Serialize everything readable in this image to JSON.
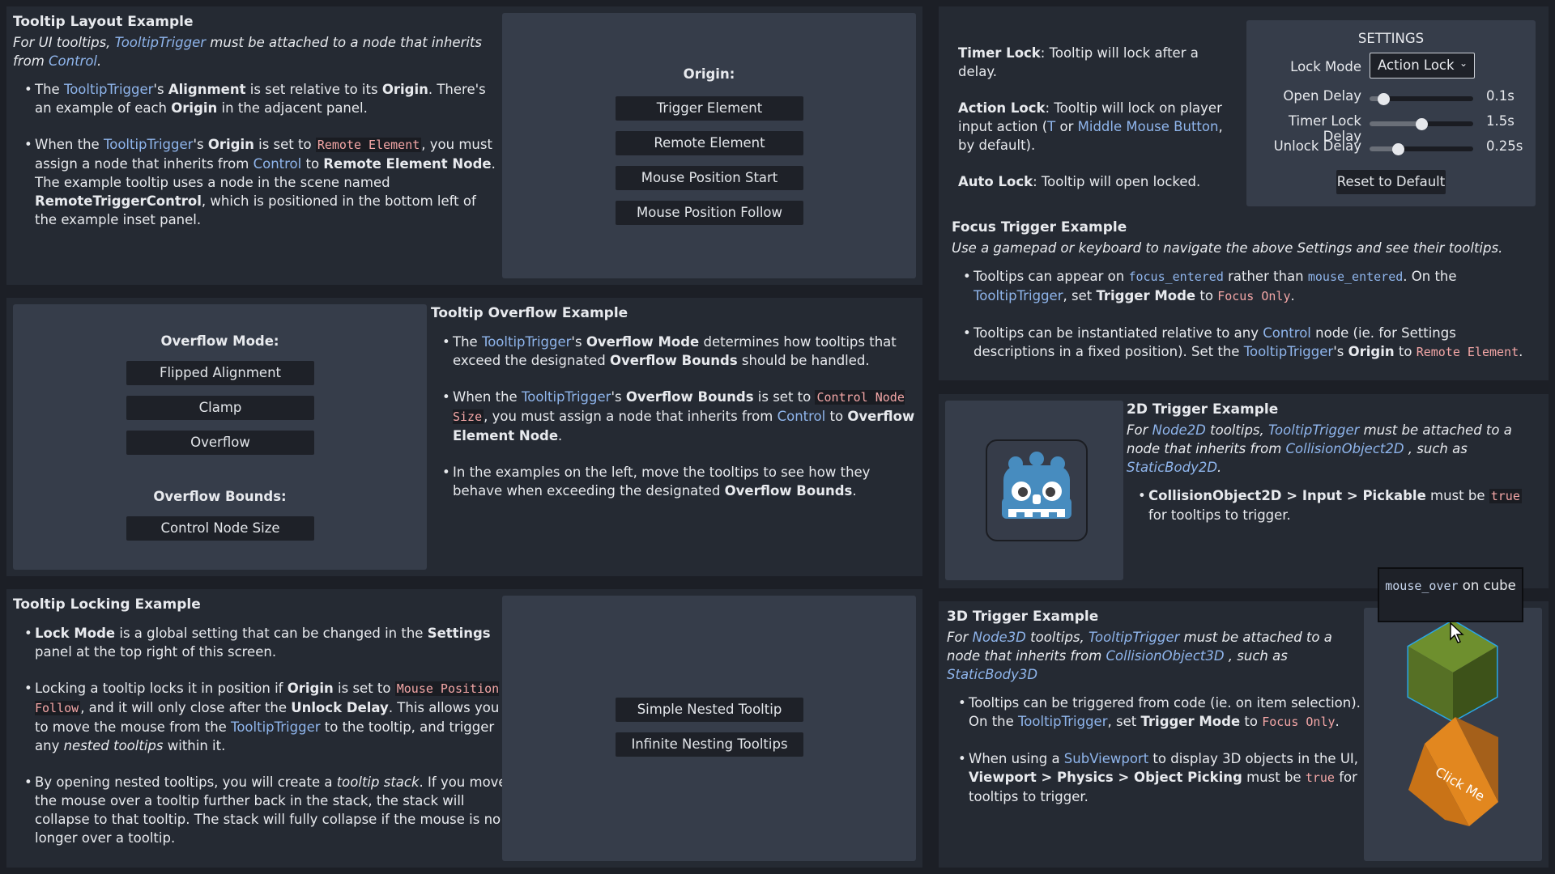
{
  "layout_panel": {
    "title": "Tooltip Layout Example",
    "sub_a": "For UI tooltips, ",
    "sub_b": "TooltipTrigger",
    "sub_c": " must be attached to a node that inherits from ",
    "sub_d": "Control",
    "sub_e": ".",
    "b1": {
      "t1": "The ",
      "h1": "TooltipTrigger",
      "t2": "'s ",
      "b1": "Alignment",
      "t3": " is set relative to its ",
      "b2": "Origin",
      "t4": ". There's an example of each ",
      "b3": "Origin",
      "t5": " in the adjacent panel."
    },
    "b2": {
      "t1": "When the ",
      "h1": "TooltipTrigger",
      "t2": "'s ",
      "b1": "Origin",
      "t3": " is set to ",
      "k1": "Remote Element",
      "t4": ", you must assign a node that inherits from ",
      "h2": "Control",
      "t5": " to ",
      "b2": "Remote Element Node",
      "t6": ". The example tooltip uses a node in the scene named ",
      "b3": "RemoteTriggerControl",
      "t7": ", which is positioned in the bottom left of the example inset panel."
    },
    "origin_label": "Origin:",
    "buttons": [
      "Trigger Element",
      "Remote Element",
      "Mouse Position Start",
      "Mouse Position Follow"
    ]
  },
  "overflow_panel": {
    "title": "Tooltip Overflow Example",
    "mode_label": "Overflow Mode:",
    "mode_buttons": [
      "Flipped Alignment",
      "Clamp",
      "Overflow"
    ],
    "bounds_label": "Overflow Bounds:",
    "bounds_button": "Control Node Size",
    "b1": {
      "t1": "The ",
      "h1": "TooltipTrigger",
      "t2": "'s ",
      "b1": "Overflow Mode",
      "t3": " determines how tooltips that exceed the designated ",
      "b2": "Overflow Bounds",
      "t4": " should be handled."
    },
    "b2": {
      "t1": "When the ",
      "h1": "TooltipTrigger",
      "t2": "'s ",
      "b1": "Overflow Bounds",
      "t3": " is set to ",
      "k1": "Control Node Size",
      "t4": ", you must assign a node that inherits from ",
      "h2": "Control",
      "t5": " to ",
      "b2": "Overflow Element Node",
      "t6": "."
    },
    "b3": {
      "t1": "In the examples on the left, move the tooltips to see how they behave when exceeding the designated ",
      "b1": "Overflow Bounds",
      "t2": "."
    }
  },
  "locking_panel": {
    "title": "Tooltip Locking Example",
    "b1": {
      "b1": "Lock Mode",
      "t1": " is a global setting that can be changed in the ",
      "b2": "Settings",
      "t2": " panel at the top right of this screen."
    },
    "b2": {
      "t1": "Locking a tooltip locks it in position if ",
      "b1": "Origin",
      "t2": " is set to ",
      "k1": "Mouse Position Follow",
      "t3": ", and it will only close after the ",
      "b2": "Unlock Delay",
      "t4": ". This allows you to move the mouse from the ",
      "h1": "TooltipTrigger",
      "t5": " to the tooltip, and trigger any ",
      "i1": "nested tooltips",
      "t6": " within it."
    },
    "b3": {
      "t1": "By opening nested tooltips, you will create a ",
      "i1": "tooltip stack",
      "t2": ". If you move the mouse over a tooltip further back in the stack, the stack will collapse to that tooltip. The stack will fully collapse if the mouse is no longer over a tooltip."
    },
    "buttons": [
      "Simple Nested Tooltip",
      "Infinite Nesting Tooltips"
    ]
  },
  "settings_panel": {
    "timer": {
      "b": "Timer Lock",
      "t": ": Tooltip will lock after a delay."
    },
    "action": {
      "b": "Action Lock",
      "t1": ": Tooltip will lock on player input action (",
      "h1": "T",
      "t2": " or  ",
      "h2": "Middle Mouse Button",
      "t3": ", by default)."
    },
    "auto": {
      "b": "Auto Lock",
      "t": ": Tooltip will open locked."
    },
    "settings_title": "SETTINGS",
    "lock_mode_label": "Lock Mode",
    "lock_mode_value": "Action Lock",
    "sliders": [
      {
        "label": "Open Delay",
        "value": "0.1s",
        "fraction": 0.14
      },
      {
        "label": "Timer Lock Delay",
        "value": "1.5s",
        "fraction": 0.5
      },
      {
        "label": "Unlock Delay",
        "value": "0.25s",
        "fraction": 0.28
      }
    ],
    "reset_button": "Reset to Default",
    "focus_title": "Focus Trigger Example",
    "focus_sub": "Use a gamepad or keyboard to navigate the above Settings and see their tooltips.",
    "f1": {
      "t1": "Tooltips can appear on ",
      "c1": "focus_entered",
      "t2": " rather than ",
      "c2": "mouse_entered",
      "t3": ". On the ",
      "h1": "TooltipTrigger",
      "t4": ", set ",
      "b1": "Trigger Mode",
      "t5": " to ",
      "k1": "Focus Only",
      "t6": "."
    },
    "f2": {
      "t1": "Tooltips can be instantiated relative to any ",
      "h1": "Control",
      "t2": " node (ie. for Settings descriptions in a fixed position). Set the ",
      "h2": "TooltipTrigger",
      "t3": "'s ",
      "b1": "Origin",
      "t4": " to ",
      "k1": "Remote Element",
      "t5": "."
    }
  },
  "trigger2d_panel": {
    "title": "2D Trigger Example",
    "sub": {
      "t1": "For ",
      "h1": "Node2D",
      "t2": " tooltips, ",
      "h2": "TooltipTrigger",
      "t3": " must be attached to a node that inherits from ",
      "h3": "CollisionObject2D",
      "t4": " , such as ",
      "h4": "StaticBody2D",
      "t5": "."
    },
    "b1": {
      "b1": "CollisionObject2D > Input > Pickable",
      "t1": " must be ",
      "k1": "true",
      "t2": " for tooltips to trigger."
    }
  },
  "trigger3d_panel": {
    "title": "3D Trigger Example",
    "sub": {
      "t1": "For ",
      "h1": "Node3D",
      "t2": " tooltips, ",
      "h2": "TooltipTrigger",
      "t3": " must be attached to a node that inherits from ",
      "h3": "CollisionObject3D",
      "t4": " , such as ",
      "h4": "StaticBody3D"
    },
    "b1": {
      "t1": "Tooltips can be triggered from code (ie. on item selection). On the ",
      "h1": "TooltipTrigger",
      "t2": ", set ",
      "b1": "Trigger Mode",
      "t3": " to ",
      "k1": "Focus Only",
      "t4": "."
    },
    "b2": {
      "t1": "When using a ",
      "h1": "SubViewport",
      "t2": " to display 3D objects in the UI, ",
      "b1": "Viewport > Physics > Object Picking",
      "t3": " must be ",
      "k1": "true",
      "t4": " for tooltips to trigger."
    },
    "tooltip": {
      "c1": "mouse_over",
      "t1": " on cube"
    },
    "click_me": "Click Me"
  },
  "colors": {
    "panel": "#252a33",
    "inset": "#363d4a",
    "link": "#8fb5ec",
    "keyword": "#f3a6a6",
    "godot": "#478cbf"
  }
}
